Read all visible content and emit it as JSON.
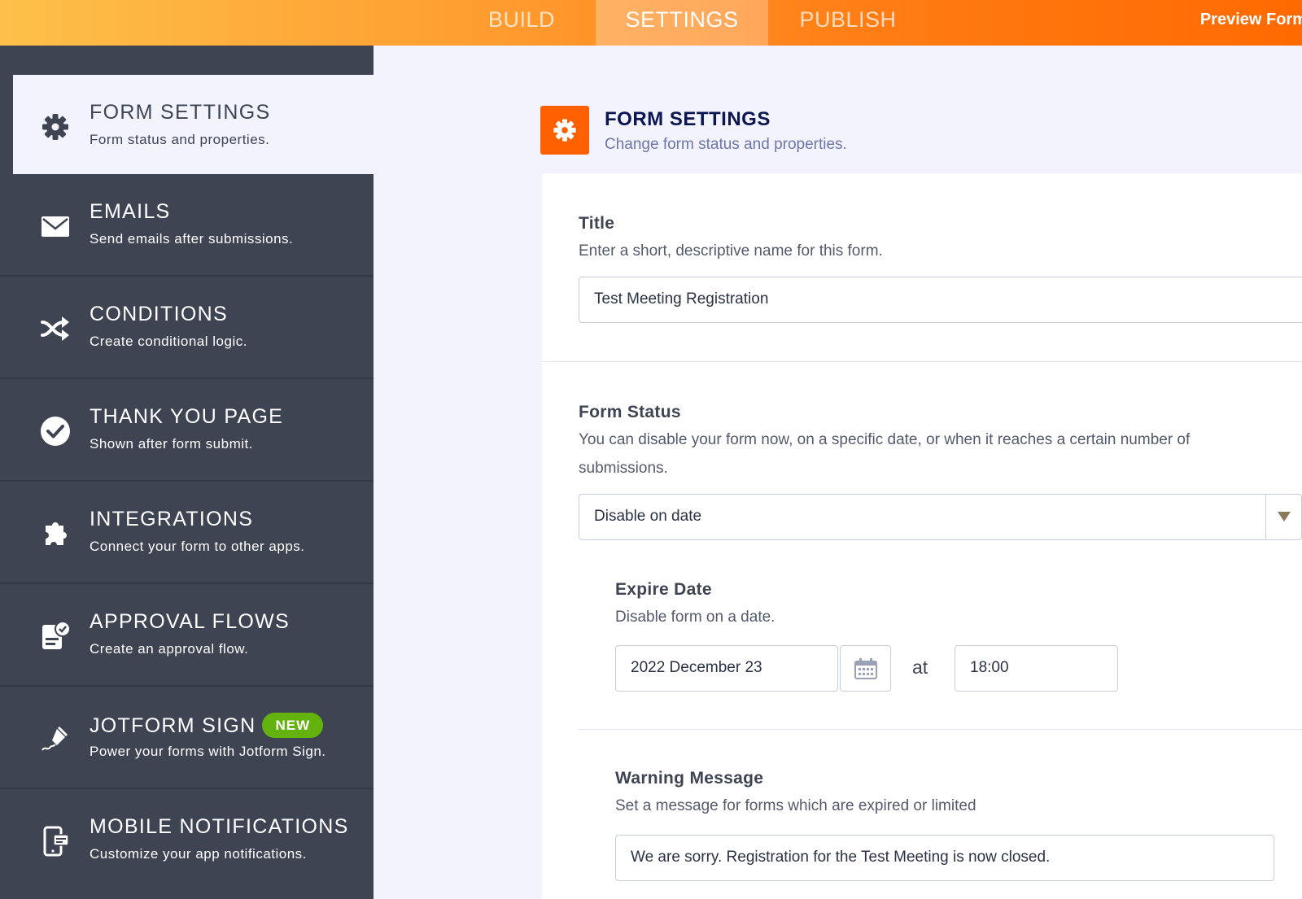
{
  "topbar": {
    "tabs": [
      {
        "label": "BUILD"
      },
      {
        "label": "SETTINGS",
        "active": true
      },
      {
        "label": "PUBLISH"
      }
    ],
    "preview_label": "Preview Form"
  },
  "sidebar": {
    "items": [
      {
        "title": "FORM SETTINGS",
        "desc": "Form status and properties.",
        "icon": "gear-icon",
        "active": true
      },
      {
        "title": "EMAILS",
        "desc": "Send emails after submissions.",
        "icon": "envelope-icon"
      },
      {
        "title": "CONDITIONS",
        "desc": "Create conditional logic.",
        "icon": "shuffle-icon"
      },
      {
        "title": "THANK YOU PAGE",
        "desc": "Shown after form submit.",
        "icon": "check-circle-icon"
      },
      {
        "title": "INTEGRATIONS",
        "desc": "Connect your form to other apps.",
        "icon": "puzzle-icon"
      },
      {
        "title": "APPROVAL FLOWS",
        "desc": "Create an approval flow.",
        "icon": "approval-icon"
      },
      {
        "title": "JOTFORM SIGN",
        "desc": "Power your forms with Jotform Sign.",
        "icon": "pen-sign-icon",
        "badge": "NEW"
      },
      {
        "title": "MOBILE NOTIFICATIONS",
        "desc": "Customize your app notifications.",
        "icon": "mobile-notification-icon"
      }
    ]
  },
  "main": {
    "header": {
      "title": "FORM SETTINGS",
      "subtitle": "Change form status and properties.",
      "icon": "gear-icon"
    },
    "title_field": {
      "label": "Title",
      "help": "Enter a short, descriptive name for this form.",
      "value": "Test Meeting Registration"
    },
    "status_field": {
      "label": "Form Status",
      "help_line1": "You can disable your form now, on a specific date, or when it reaches a certain number of",
      "help_line2": "submissions.",
      "value": "Disable on date"
    },
    "expire": {
      "label": "Expire Date",
      "help": "Disable form on a date.",
      "date": "2022 December 23",
      "at": "at",
      "time": "18:00"
    },
    "warning": {
      "label": "Warning Message",
      "help": "Set a message for forms which are expired or limited",
      "value": "We are sorry.  Registration for the Test Meeting is now closed."
    }
  },
  "colors": {
    "accent": "#ff6100",
    "sidebar": "#3e4452",
    "badge": "#64b20e",
    "heading": "#0a1551"
  }
}
